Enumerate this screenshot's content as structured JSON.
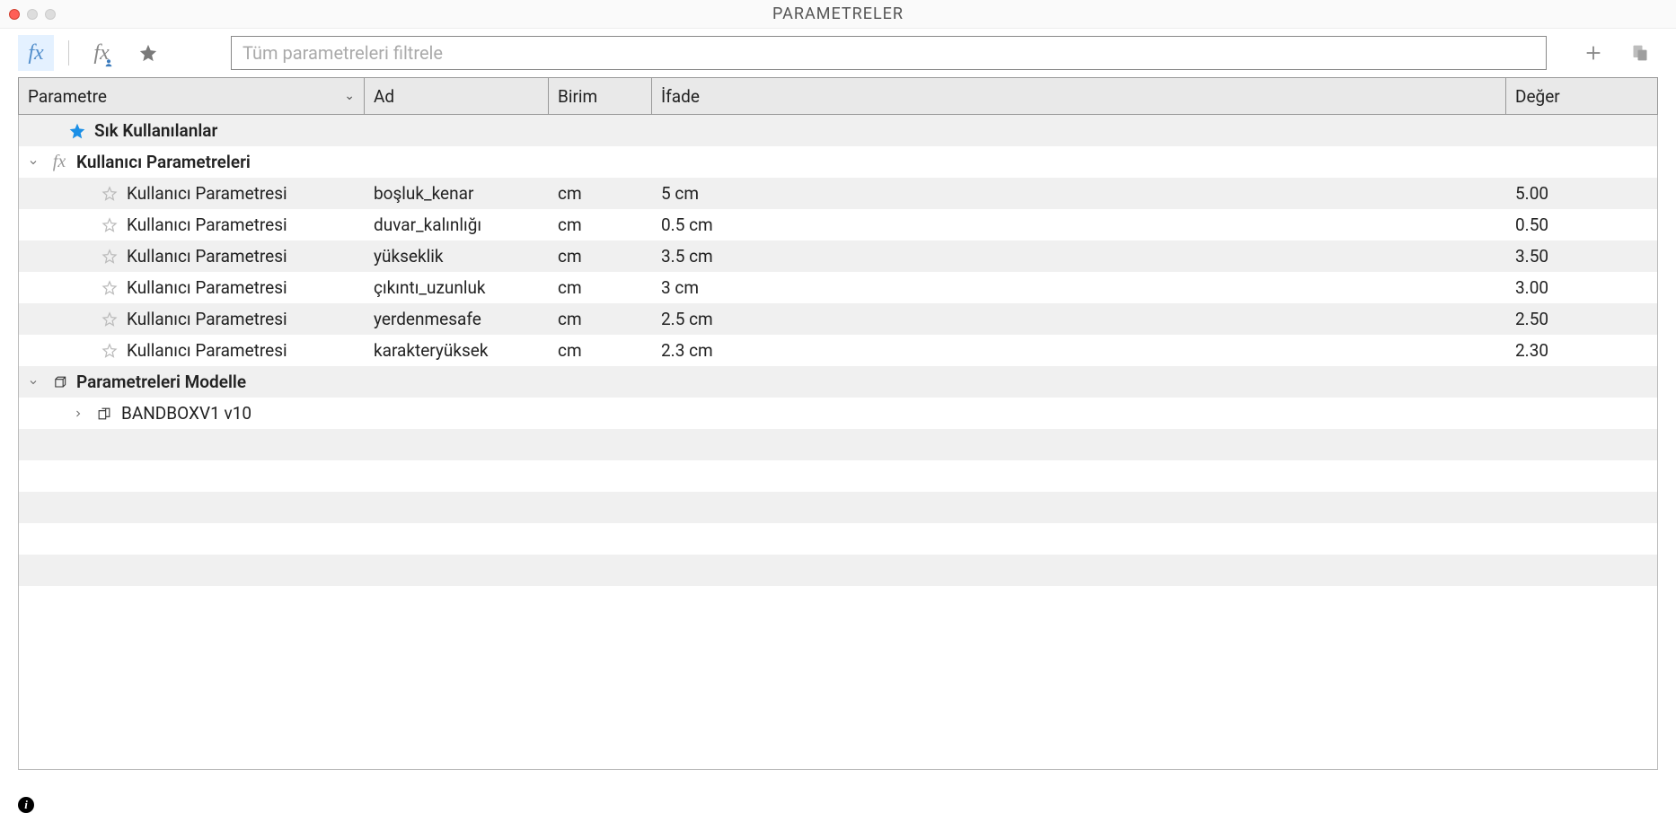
{
  "window": {
    "title": "PARAMETRELER"
  },
  "toolbar": {
    "filter_placeholder": "Tüm parametreleri filtrele"
  },
  "columns": {
    "parameter": "Parametre",
    "name": "Ad",
    "unit": "Birim",
    "expression": "İfade",
    "value": "Değer"
  },
  "groups": {
    "favorites": "Sık Kullanılanlar",
    "user_params": "Kullanıcı Parametreleri",
    "model_params": "Parametreleri Modelle"
  },
  "user_type_label": "Kullanıcı Parametresi",
  "model_item": "BANDBOXV1 v10",
  "params": [
    {
      "name": "boşluk_kenar",
      "unit": "cm",
      "expr": "5 cm",
      "value": "5.00"
    },
    {
      "name": "duvar_kalınlığı",
      "unit": "cm",
      "expr": "0.5 cm",
      "value": "0.50"
    },
    {
      "name": "yükseklik",
      "unit": "cm",
      "expr": "3.5 cm",
      "value": "3.50"
    },
    {
      "name": "çıkıntı_uzunluk",
      "unit": "cm",
      "expr": "3 cm",
      "value": "3.00"
    },
    {
      "name": "yerdenmesafe",
      "unit": "cm",
      "expr": "2.5 cm",
      "value": "2.50"
    },
    {
      "name": "karakteryüksek",
      "unit": "cm",
      "expr": "2.3 cm",
      "value": "2.30"
    }
  ]
}
